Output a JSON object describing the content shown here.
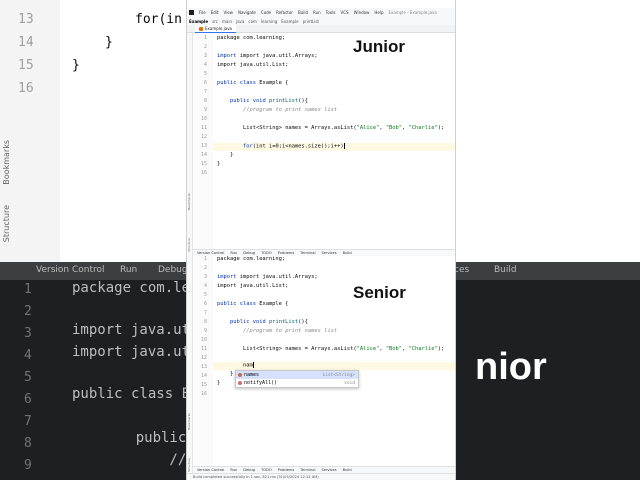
{
  "background": {
    "line_numbers": [
      "13",
      "14",
      "15",
      "16"
    ],
    "code_lines": [
      "for(in",
      "}",
      "}"
    ],
    "side_labels": [
      "Bookmarks",
      "Structure"
    ],
    "bottom_bar": [
      "Version Control",
      "Run",
      "Debug",
      "ces",
      "Build"
    ],
    "dark_line_numbers": [
      "1",
      "2",
      "3",
      "4",
      "5",
      "6",
      "7",
      "8",
      "9"
    ],
    "dark_code": [
      "package com.lea",
      "",
      "import java.uti",
      "import java.uti",
      "",
      "public class Ex",
      "",
      "    public voi",
      "        //prog"
    ],
    "big_text": "nior"
  },
  "ide": {
    "menu": [
      "File",
      "Edit",
      "View",
      "Navigate",
      "Code",
      "Refactor",
      "Build",
      "Run",
      "Tools",
      "VCS",
      "Window",
      "Help"
    ],
    "window_title": "Example - Example.java",
    "breadcrumb": [
      "Example",
      "src",
      "main",
      "java",
      "com",
      "learning",
      "Example",
      "printList"
    ],
    "tab_label": "Example.java",
    "left_strip": [
      "Bookmarks",
      "Structure"
    ],
    "toolbar": [
      "Version Control",
      "Run",
      "Debug",
      "TODO",
      "Problems",
      "Terminal",
      "Services",
      "Build"
    ],
    "status": "Build completed successfully in 1 sec, 821 ms (31/03/2024 12:12 AM)"
  },
  "junior": {
    "label": "Junior",
    "line_numbers": [
      "1",
      "2",
      "3",
      "4",
      "5",
      "6",
      "7",
      "8",
      "9",
      "10",
      "11",
      "12",
      "13",
      "14",
      "15",
      "16"
    ],
    "lines": {
      "l1": "package com.learning;",
      "l3": "import java.util.Arrays;",
      "l4": "import java.util.List;",
      "l6_kw": "public class ",
      "l6_rest": "Example {",
      "l8_kw": "public void ",
      "l8_fn": "printList",
      "l8_rest": "(){",
      "l9": "//program to print names list",
      "l11_a": "List<String> names = Arrays.asList(",
      "l11_s1": "\"Alice\"",
      "l11_s2": "\"Bob\"",
      "l11_s3": "\"Charlie\"",
      "l11_b": ");",
      "l13_kw": "for",
      "l13_rest": "(int i=0;i<names.size();i++)",
      "l14": "}",
      "l15": "}"
    }
  },
  "senior": {
    "label": "Senior",
    "line_numbers": [
      "1",
      "2",
      "3",
      "4",
      "5",
      "6",
      "7",
      "8",
      "9",
      "10",
      "11",
      "12",
      "13",
      "14",
      "15",
      "16"
    ],
    "lines": {
      "l1": "package com.learning;",
      "l3": "import java.util.Arrays;",
      "l4": "import java.util.List;",
      "l6_kw": "public class ",
      "l6_rest": "Example {",
      "l8_kw": "public void ",
      "l8_fn": "printList",
      "l8_rest": "(){",
      "l9": "//program to print names list",
      "l11_a": "List<String> names = Arrays.asList(",
      "l11_s1": "\"Alice\"",
      "l11_s2": "\"Bob\"",
      "l11_s3": "\"Charlie\"",
      "l11_b": ");",
      "l13": "nam",
      "l14": "}",
      "l15": "}"
    },
    "completion": [
      {
        "name": "names",
        "type": "List<String>"
      },
      {
        "name": "notifyAll()",
        "type": "void"
      }
    ]
  }
}
